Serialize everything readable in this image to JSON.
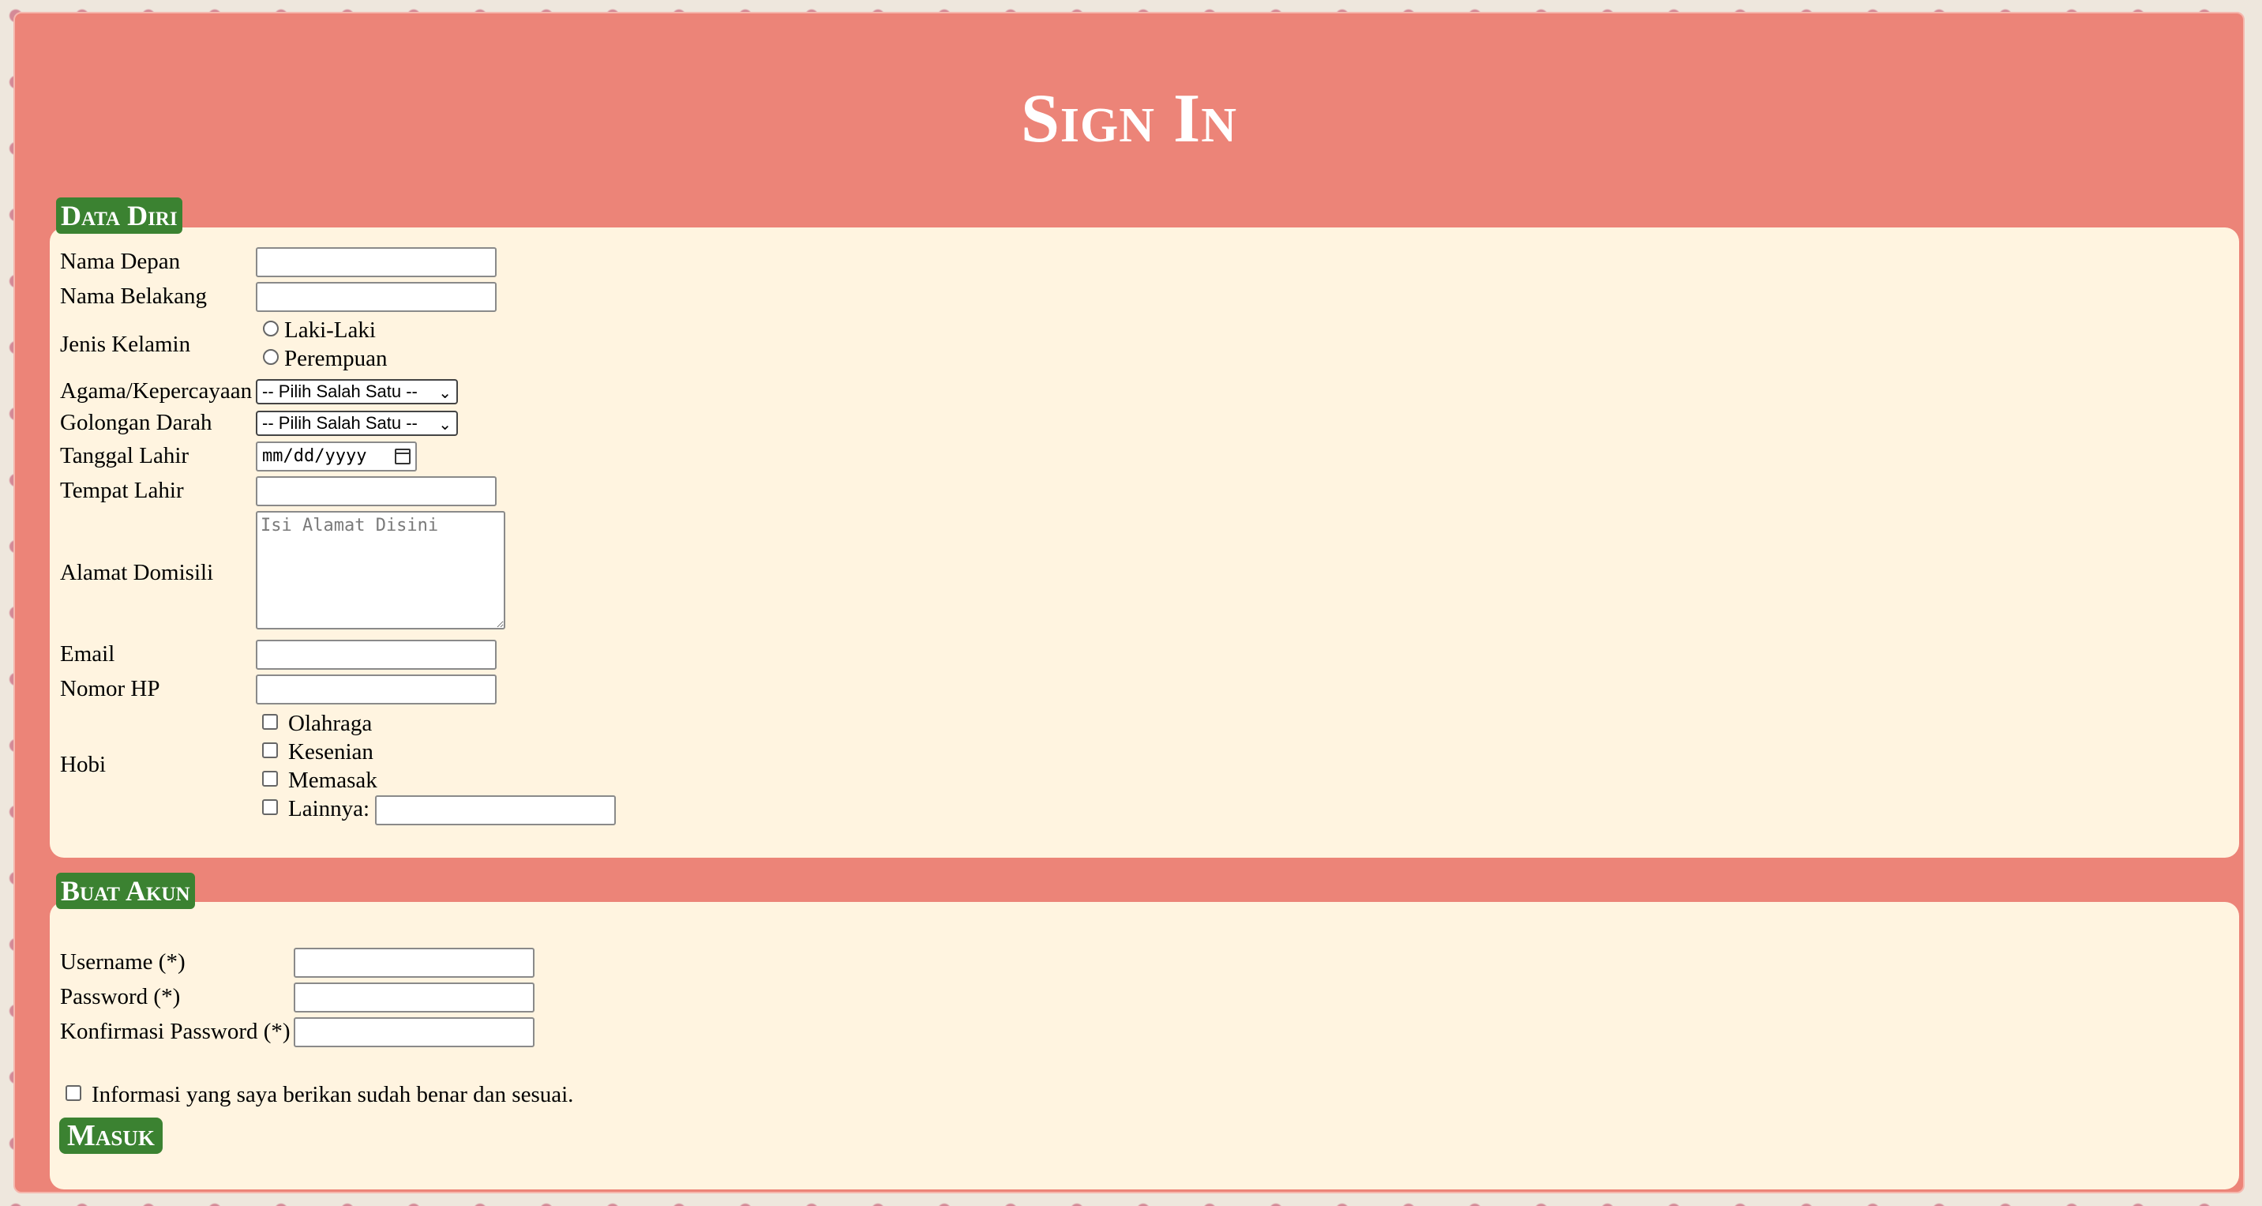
{
  "page": {
    "title": "Sign In"
  },
  "data_diri": {
    "legend": "Data Diri",
    "nama_depan_label": "Nama Depan",
    "nama_belakang_label": "Nama Belakang",
    "jenis_kelamin_label": "Jenis Kelamin",
    "gender_options": [
      "Laki-Laki",
      "Perempuan"
    ],
    "agama_label": "Agama/Kepercayaan",
    "agama_selected": "-- Pilih Salah Satu --",
    "golongan_label": "Golongan Darah",
    "golongan_selected": "-- Pilih Salah Satu --",
    "tanggal_label": "Tanggal Lahir",
    "tanggal_placeholder": "mm/dd/yyyy",
    "tempat_label": "Tempat Lahir",
    "alamat_label": "Alamat Domisili",
    "alamat_placeholder": "Isi Alamat Disini",
    "email_label": "Email",
    "hp_label": "Nomor HP",
    "hobi_label": "Hobi",
    "hobi_options": [
      "Olahraga",
      "Kesenian",
      "Memasak",
      "Lainnya:"
    ]
  },
  "buat_akun": {
    "legend": "Buat Akun",
    "username_label": "Username (*)",
    "password_label": "Password (*)",
    "konfirmasi_label": "Konfirmasi Password (*)",
    "agree_label": "Informasi yang saya berikan sudah benar dan sesuai.",
    "submit_label": "Masuk"
  },
  "colors": {
    "frame": "#ec8478",
    "panel": "#fff4e0",
    "accent": "#3b8231"
  }
}
